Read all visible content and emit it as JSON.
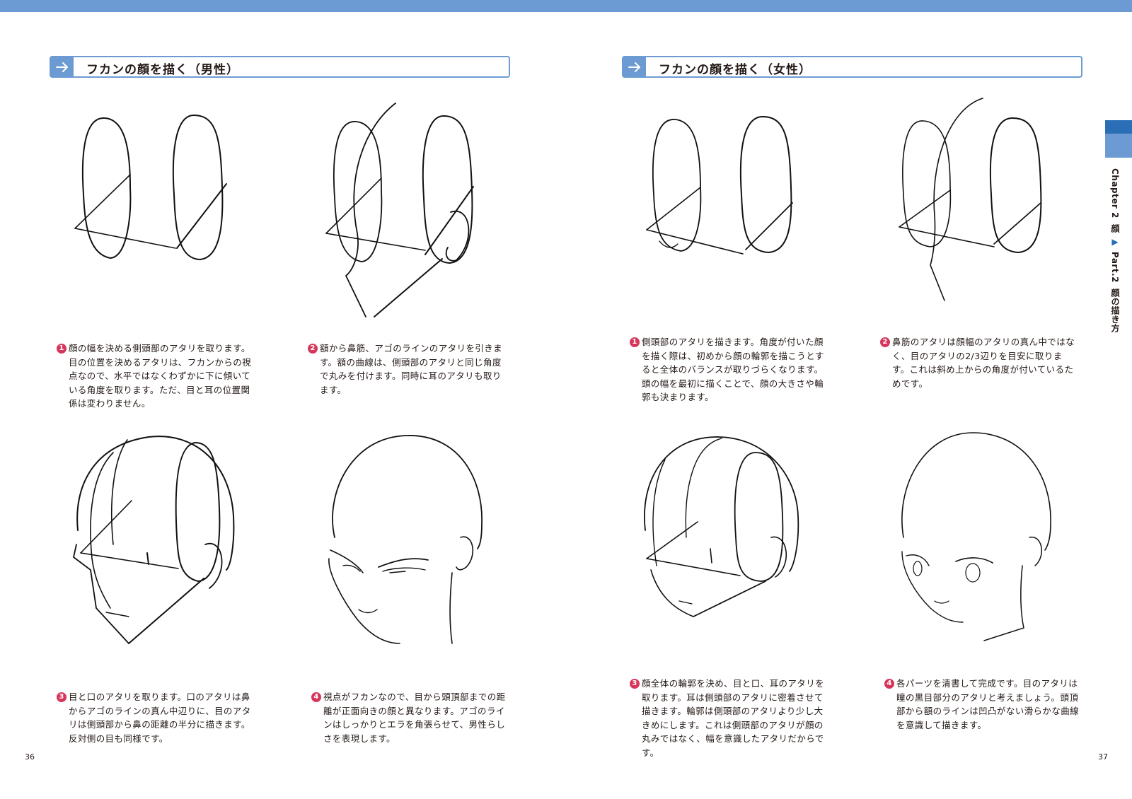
{
  "left_page": {
    "section_title": "フカンの顔を描く（男性）",
    "steps": [
      {
        "num": "1",
        "text": "顔の幅を決める側頭部のアタリを取ります。目の位置を決めるアタリは、フカンからの視点なので、水平ではなくわずかに下に傾いている角度を取ります。ただ、目と耳の位置関係は変わりません。"
      },
      {
        "num": "2",
        "text": "額から鼻筋、アゴのラインのアタリを引きます。額の曲線は、側頭部のアタリと同じ角度で丸みを付けます。同時に耳のアタリも取ります。"
      },
      {
        "num": "3",
        "text": "目と口のアタリを取ります。口のアタリは鼻からアゴのラインの真ん中辺りに、目のアタリは側頭部から鼻の距離の半分に描きます。反対側の目も同様です。"
      },
      {
        "num": "4",
        "text": "視点がフカンなので、目から頭頂部までの距離が正面向きの顔と異なります。アゴのラインはしっかりとエラを角張らせて、男性らしさを表現します。"
      }
    ],
    "page_number": "36"
  },
  "right_page": {
    "section_title": "フカンの顔を描く（女性）",
    "steps": [
      {
        "num": "1",
        "text": "側頭部のアタリを描きます。角度が付いた顔を描く際は、初めから顔の輪郭を描こうとすると全体のバランスが取りづらくなります。頭の幅を最初に描くことで、顔の大きさや輪郭も決まります。"
      },
      {
        "num": "2",
        "text": "鼻筋のアタリは顔幅のアタリの真ん中ではなく、目のアタリの2/3辺りを目安に取ります。これは斜め上からの角度が付いているためです。"
      },
      {
        "num": "3",
        "text": "顔全体の輪郭を決め、目と口、耳のアタリを取ります。耳は側頭部のアタリに密着させて描きます。輪郭は側頭部のアタリより少し大きめにします。これは側頭部のアタリが顔の丸みではなく、幅を意識したアタリだからです。"
      },
      {
        "num": "4",
        "text": "各パーツを清書して完成です。目のアタリは瞳の黒目部分のアタリと考えましょう。頭頂部から額のラインは凹凸がない滑らかな曲線を意識して描きます。"
      }
    ],
    "page_number": "37"
  },
  "side_tab": {
    "chapter": "Chapter 2",
    "chapter_name": "顔",
    "triangle": "▶",
    "part": "Part.2",
    "part_name": "顔の描き方"
  },
  "icons": [
    "arrow-right-icon"
  ],
  "colors": {
    "accent_blue": "#6b9bd2",
    "dark_blue": "#2a6fb5",
    "number_red": "#d6365c"
  }
}
